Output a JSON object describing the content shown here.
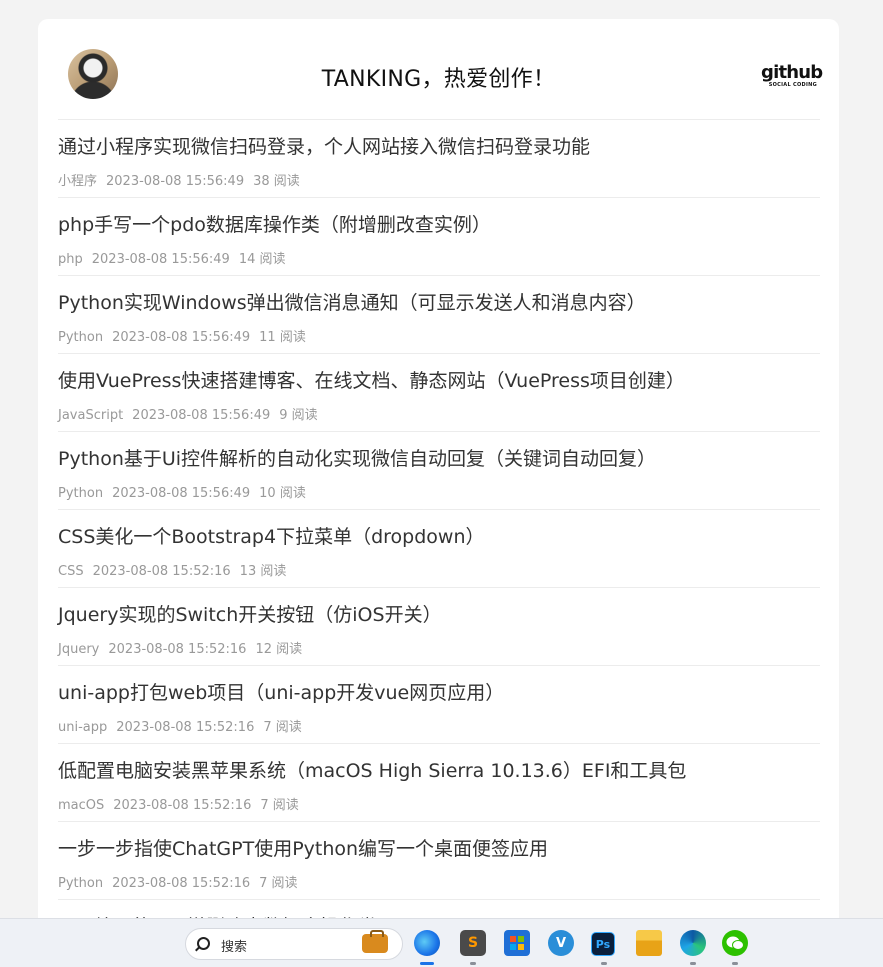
{
  "site": {
    "title": "TANKING，热爱创作！",
    "github_logo": "github",
    "github_sub": "SOCIAL CODING"
  },
  "articles": [
    {
      "title": "通过小程序实现微信扫码登录，个人网站接入微信扫码登录功能",
      "category": "小程序",
      "date": "2023-08-08 15:56:49",
      "views": "38 阅读"
    },
    {
      "title": "php手写一个pdo数据库操作类（附增删改查实例）",
      "category": "php",
      "date": "2023-08-08 15:56:49",
      "views": "14 阅读"
    },
    {
      "title": "Python实现Windows弹出微信消息通知（可显示发送人和消息内容）",
      "category": "Python",
      "date": "2023-08-08 15:56:49",
      "views": "11 阅读"
    },
    {
      "title": "使用VuePress快速搭建博客、在线文档、静态网站（VuePress项目创建）",
      "category": "JavaScript",
      "date": "2023-08-08 15:56:49",
      "views": "9 阅读"
    },
    {
      "title": "Python基于Ui控件解析的自动化实现微信自动回复（关键词自动回复）",
      "category": "Python",
      "date": "2023-08-08 15:56:49",
      "views": "10 阅读"
    },
    {
      "title": "CSS美化一个Bootstrap4下拉菜单（dropdown）",
      "category": "CSS",
      "date": "2023-08-08 15:52:16",
      "views": "13 阅读"
    },
    {
      "title": "Jquery实现的Switch开关按钮（仿iOS开关）",
      "category": "Jquery",
      "date": "2023-08-08 15:52:16",
      "views": "12 阅读"
    },
    {
      "title": "uni-app打包web项目（uni-app开发vue网页应用）",
      "category": "uni-app",
      "date": "2023-08-08 15:52:16",
      "views": "7 阅读"
    },
    {
      "title": "低配置电脑安装黑苹果系统（macOS High Sierra 10.13.6）EFI和工具包",
      "category": "macOS",
      "date": "2023-08-08 15:52:16",
      "views": "7 阅读"
    },
    {
      "title": "一步一步指使ChatGPT使用Python编写一个桌面便签应用",
      "category": "Python",
      "date": "2023-08-08 15:52:16",
      "views": "7 阅读"
    },
    {
      "title": "php编写的pdo增删改查数据库操作类",
      "category": "",
      "date": "",
      "views": ""
    }
  ],
  "taskbar": {
    "search_placeholder": "搜索",
    "apps": [
      "windows-start-icon",
      "edge-icon",
      "sublime-text-icon",
      "microsoft-store-icon",
      "vs-icon",
      "photoshop-icon",
      "file-explorer-icon",
      "edge-dev-icon",
      "wechat-icon"
    ],
    "ps_label": "Ps",
    "vs_label": "V"
  }
}
